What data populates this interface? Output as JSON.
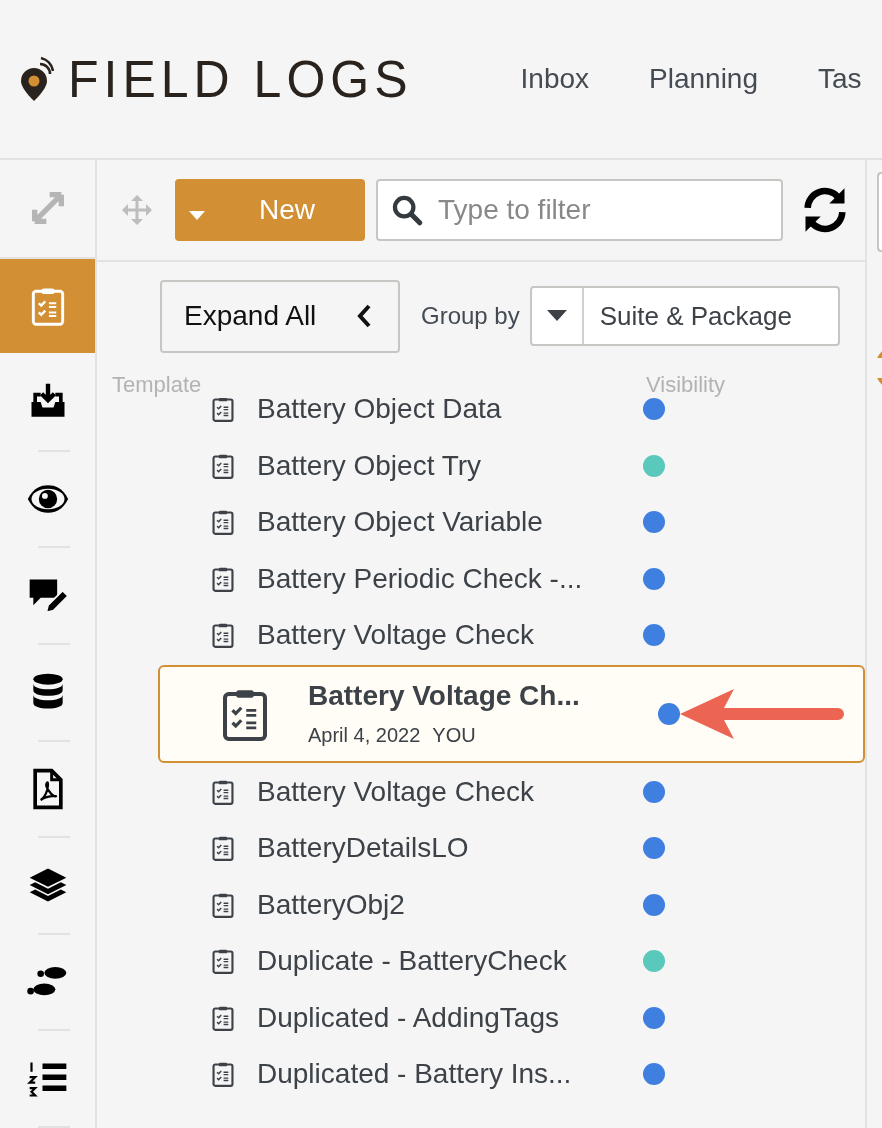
{
  "header": {
    "logo": "FIELD LOGS",
    "nav": [
      {
        "label": "Inbox"
      },
      {
        "label": "Planning"
      },
      {
        "label": "Tas"
      }
    ]
  },
  "rail": {
    "items": [
      {
        "selected": true
      },
      {
        "selected": false
      },
      {
        "selected": false
      },
      {
        "selected": false
      },
      {
        "selected": false
      },
      {
        "selected": false
      },
      {
        "selected": false
      },
      {
        "selected": false
      },
      {
        "selected": false
      }
    ]
  },
  "toolbar": {
    "new_button": "New",
    "search": {
      "placeholder": "Type to filter"
    }
  },
  "controls": {
    "expand_button": "Expand All",
    "group_by_label": "Group by",
    "group_by_value": "Suite & Package"
  },
  "table": {
    "columns": [
      "Template",
      "Visibility"
    ],
    "rows": [
      {
        "name": "Battery Object Data",
        "color": "#3f7fe0",
        "selected": false
      },
      {
        "name": "Battery Object Try",
        "color": "#5bc8bc",
        "selected": false
      },
      {
        "name": "Battery Object Variable",
        "color": "#3f7fe0",
        "selected": false
      },
      {
        "name": "Battery Periodic Check -...",
        "color": "#3f7fe0",
        "selected": false
      },
      {
        "name": "Battery Voltage Check",
        "color": "#3f7fe0",
        "selected": false
      },
      {
        "name": "Battery Voltage Ch...",
        "color": "#3f7fe0",
        "selected": true,
        "date": "April 4, 2022",
        "author": "YOU"
      },
      {
        "name": "Battery Voltage Check",
        "color": "#3f7fe0",
        "selected": false
      },
      {
        "name": "BatteryDetailsLO",
        "color": "#3f7fe0",
        "selected": false
      },
      {
        "name": "BatteryObj2",
        "color": "#3f7fe0",
        "selected": false
      },
      {
        "name": "Duplicate - BatteryCheck",
        "color": "#5bc8bc",
        "selected": false
      },
      {
        "name": "Duplicated - AddingTags",
        "color": "#3f7fe0",
        "selected": false
      },
      {
        "name": "Duplicated - Battery Ins...",
        "color": "#3f7fe0",
        "selected": false
      }
    ]
  }
}
